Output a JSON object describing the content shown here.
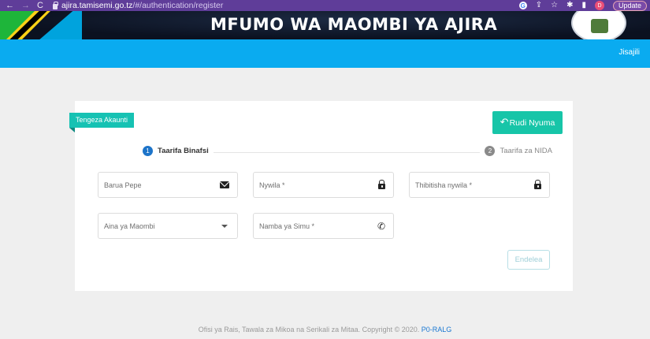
{
  "browser": {
    "url_host": "ajira.tamisemi.go.tz",
    "url_path": "/#/authentication/register",
    "avatar_letter": "D",
    "update_label": "Update"
  },
  "banner": {
    "title": "MFUMO WA MAOMBI YA AJIRA"
  },
  "navbar": {
    "register_link": "Jisajili"
  },
  "form": {
    "ribbon_label": "Tengeza Akaunti",
    "back_button": "Rudi Nyuma",
    "steps": [
      {
        "number": "1",
        "label": "Taarifa Binafsi"
      },
      {
        "number": "2",
        "label": "Taarifa za NIDA"
      }
    ],
    "fields": {
      "email": {
        "placeholder": "Barua Pepe",
        "icon": "envelope-icon"
      },
      "password": {
        "placeholder": "Nywila *",
        "icon": "lock-icon"
      },
      "confirm_password": {
        "placeholder": "Thibitisha nywila *",
        "icon": "lock-icon"
      },
      "application_type": {
        "placeholder": "Aina ya Maombi",
        "icon": "caret-down-icon"
      },
      "phone": {
        "placeholder": "Namba ya Simu *",
        "icon": "phone-icon"
      }
    },
    "next_button": "Endelea"
  },
  "footer": {
    "text": "Ofisi ya Rais, Tawala za Mikoa na Serikali za Mitaa. Copyright © 2020.",
    "org": "P0-RALG"
  },
  "colors": {
    "chrome": "#5f3d99",
    "navbar": "#0aabf0",
    "accent_teal": "#17c5a8",
    "step_active": "#1d74c9"
  }
}
